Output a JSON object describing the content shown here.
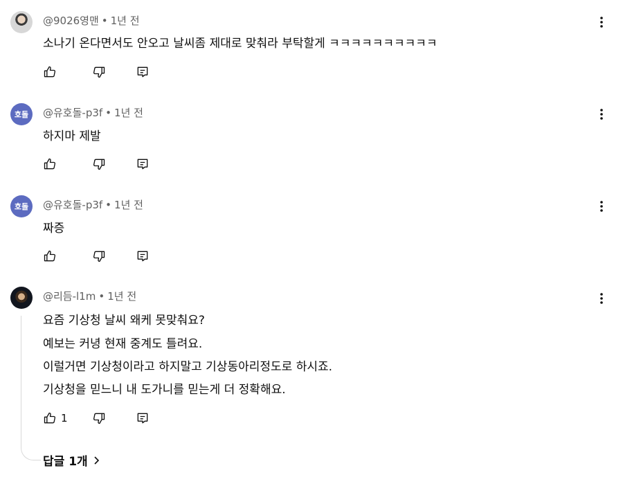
{
  "comments": [
    {
      "author": "@9026영맨",
      "time": "1년 전",
      "lines": [
        "소나기 온다면서도 안오고 날씨좀 제대로 맞춰라 부탁할게 ㅋㅋㅋㅋㅋㅋㅋㅋㅋㅋ"
      ],
      "avatar": "photo"
    },
    {
      "author": "@유호돌-p3f",
      "time": "1년 전",
      "lines": [
        "하지마 제발"
      ],
      "avatar_initials": "호돌"
    },
    {
      "author": "@유호돌-p3f",
      "time": "1년 전",
      "lines": [
        "짜증"
      ],
      "avatar_initials": "호돌"
    },
    {
      "author": "@리듬-l1m",
      "time": "1년 전",
      "lines": [
        "요즘 기상청 날씨 왜케 못맞춰요?",
        "예보는 커녕 현재 중계도 틀려요.",
        "이럴거면 기상청이라고 하지말고 기상동아리정도로 하시죠.",
        "기상청을 믿느니 내 도가니를 믿는게 더 정확해요."
      ],
      "like_count": "1",
      "avatar": "photo",
      "replies_label": "답글 1개"
    }
  ],
  "meta_separator": "•",
  "icons": {
    "like": "thumbs-up-icon",
    "dislike": "thumbs-down-icon",
    "reply": "reply-icon",
    "more": "vertical-ellipsis-icon",
    "chevron": "chevron-right-icon"
  },
  "colors": {
    "initials_avatar": "#5c6bc0",
    "meta_text": "#606060",
    "text": "#0f0f0f"
  }
}
